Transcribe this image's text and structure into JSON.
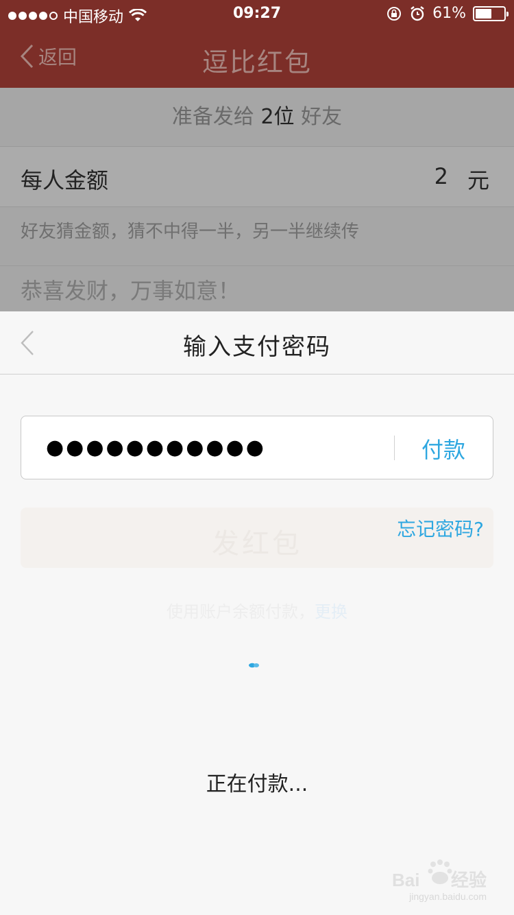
{
  "status_bar": {
    "carrier": "中国移动",
    "time": "09:27",
    "battery_percent": "61%",
    "battery_level": 0.61
  },
  "nav": {
    "back_label": "返回",
    "title": "逗比红包"
  },
  "background": {
    "recipients_prefix": "准备发给",
    "recipients_count": "2位",
    "recipients_suffix": "好友",
    "amount_label": "每人金额",
    "amount_value": "2",
    "amount_unit": "元",
    "hint": "好友猜金额，猜不中得一半，另一半继续传",
    "greeting": "恭喜发财，万事如意！"
  },
  "sheet": {
    "title": "输入支付密码",
    "password_mask": "●●●●●●●●●●●",
    "pay_label": "付款",
    "ghost_button": "发红包",
    "forgot_label": "忘记密码?",
    "ghost_line_text": "使用账户余额付款，",
    "ghost_line_link": "更换",
    "status": "正在付款..."
  },
  "watermark": {
    "text": "jingyan.baidu.com"
  },
  "colors": {
    "header_bg": "#7c2e28",
    "accent_blue": "#2ea7e0"
  }
}
